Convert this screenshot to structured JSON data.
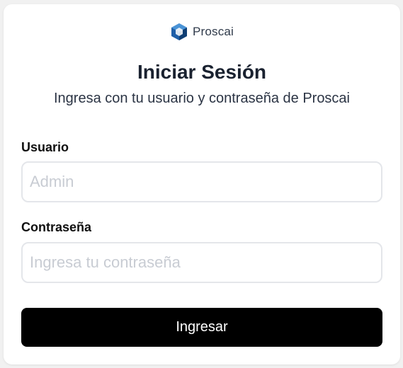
{
  "brand": {
    "name": "Proscai",
    "logo_icon": "proscai-hexagon-logo-icon",
    "logo_colors": [
      "#1f5fa8",
      "#3a86cf",
      "#0f3e73"
    ]
  },
  "header": {
    "title": "Iniciar Sesión",
    "subtitle": "Ingresa con tu usuario y contraseña de Proscai"
  },
  "form": {
    "username_label": "Usuario",
    "username_placeholder": "Admin",
    "username_value": "",
    "password_label": "Contraseña",
    "password_placeholder": "Ingresa tu contraseña",
    "password_value": "",
    "submit_label": "Ingresar"
  },
  "colors": {
    "background": "#f1f1f1",
    "card": "#ffffff",
    "button": "#000000",
    "button_text": "#ffffff"
  }
}
